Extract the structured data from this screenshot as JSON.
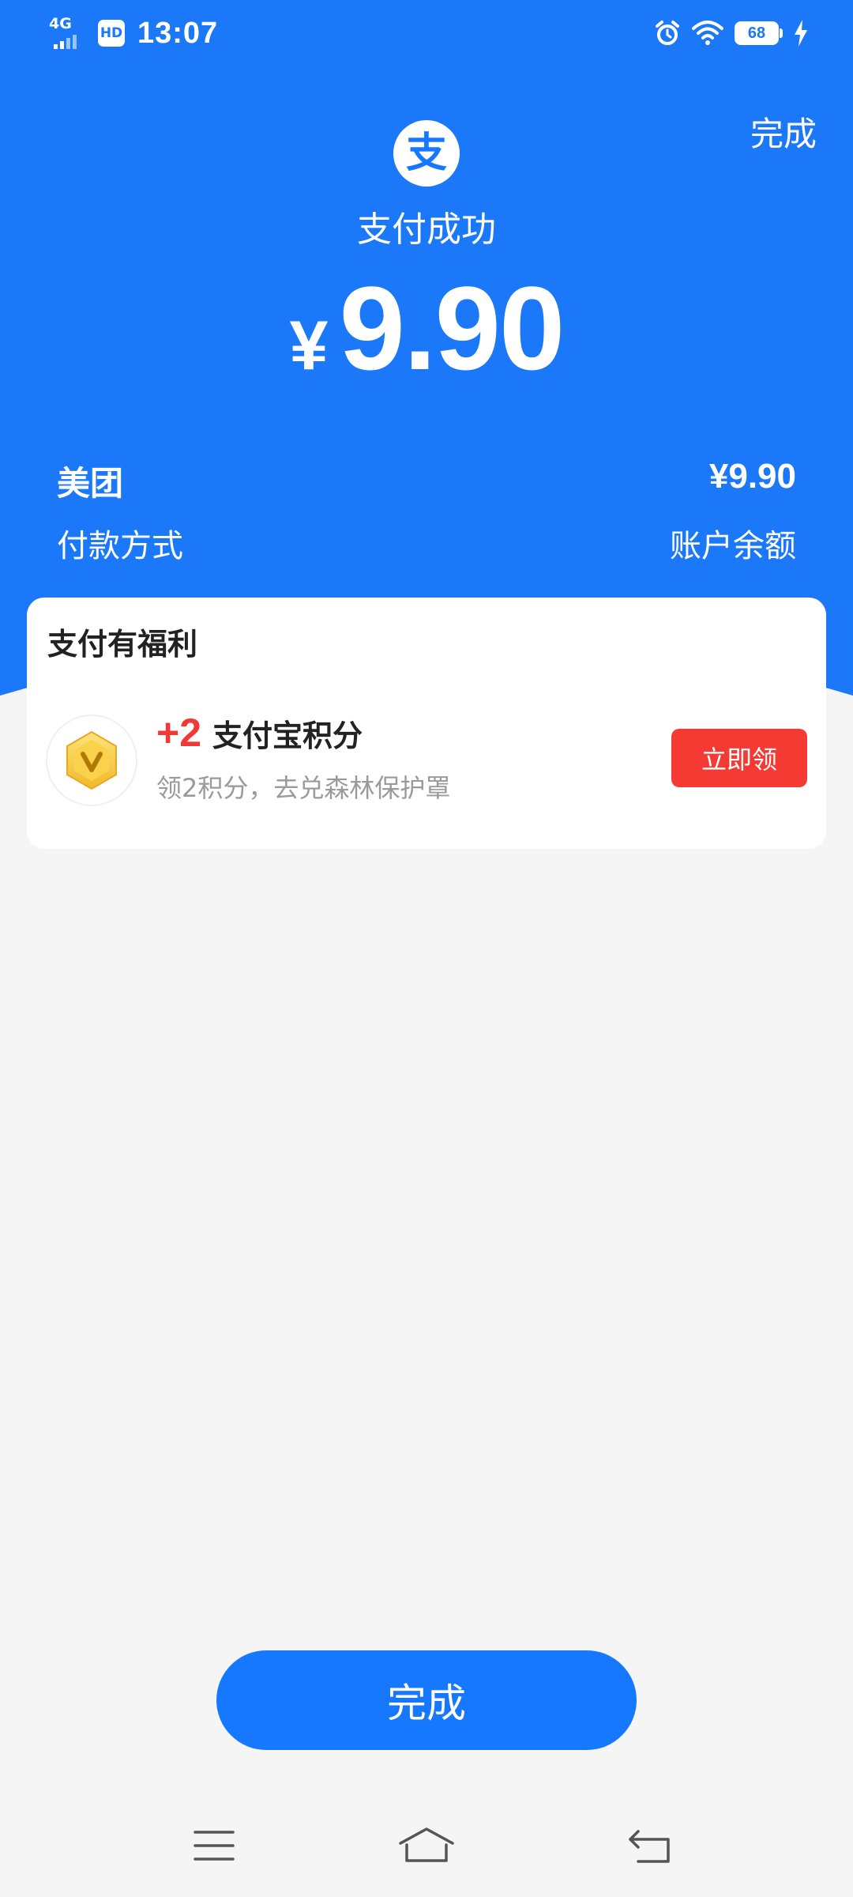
{
  "status_bar": {
    "network": "4G",
    "hd": "HD",
    "time": "13:07",
    "battery": "68",
    "icons": [
      "signal-icon",
      "alarm-icon",
      "wifi-icon",
      "battery-icon",
      "charging-icon"
    ]
  },
  "header": {
    "done_label": "完成",
    "logo_char": "支",
    "title": "支付成功",
    "currency": "¥",
    "amount": "9.90"
  },
  "details": {
    "merchant": "美团",
    "merchant_amount": "¥9.90",
    "method_label": "付款方式",
    "method_value": "账户余额"
  },
  "benefit": {
    "title": "支付有福利",
    "points": "+2",
    "points_label": "支付宝积分",
    "description": "领2积分，去兑森林保护罩",
    "button_label": "立即领",
    "icon": "coin-v-icon"
  },
  "footer": {
    "done_label": "完成"
  },
  "colors": {
    "primary_blue": "#1b78f8",
    "button_blue": "#1677ff",
    "claim_red": "#f53a33",
    "points_red": "#ef3a35",
    "background": "#f5f5f5"
  }
}
